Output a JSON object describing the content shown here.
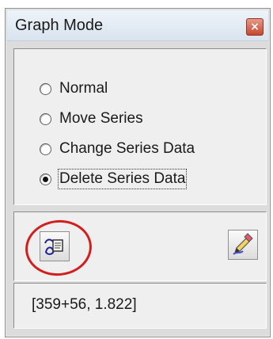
{
  "window": {
    "title": "Graph Mode",
    "close_label": "×"
  },
  "modes": {
    "options": [
      {
        "label": "Normal",
        "selected": false
      },
      {
        "label": "Move Series",
        "selected": false
      },
      {
        "label": "Change Series Data",
        "selected": false
      },
      {
        "label": "Delete Series Data",
        "selected": true
      }
    ]
  },
  "toolbar": {
    "left_tool_icon": "data-edit-icon",
    "right_tool_icon": "eraser-pencil-icon",
    "annotation_color": "#d11f1f"
  },
  "status": {
    "coordinates": "[359+56, 1.822]"
  }
}
